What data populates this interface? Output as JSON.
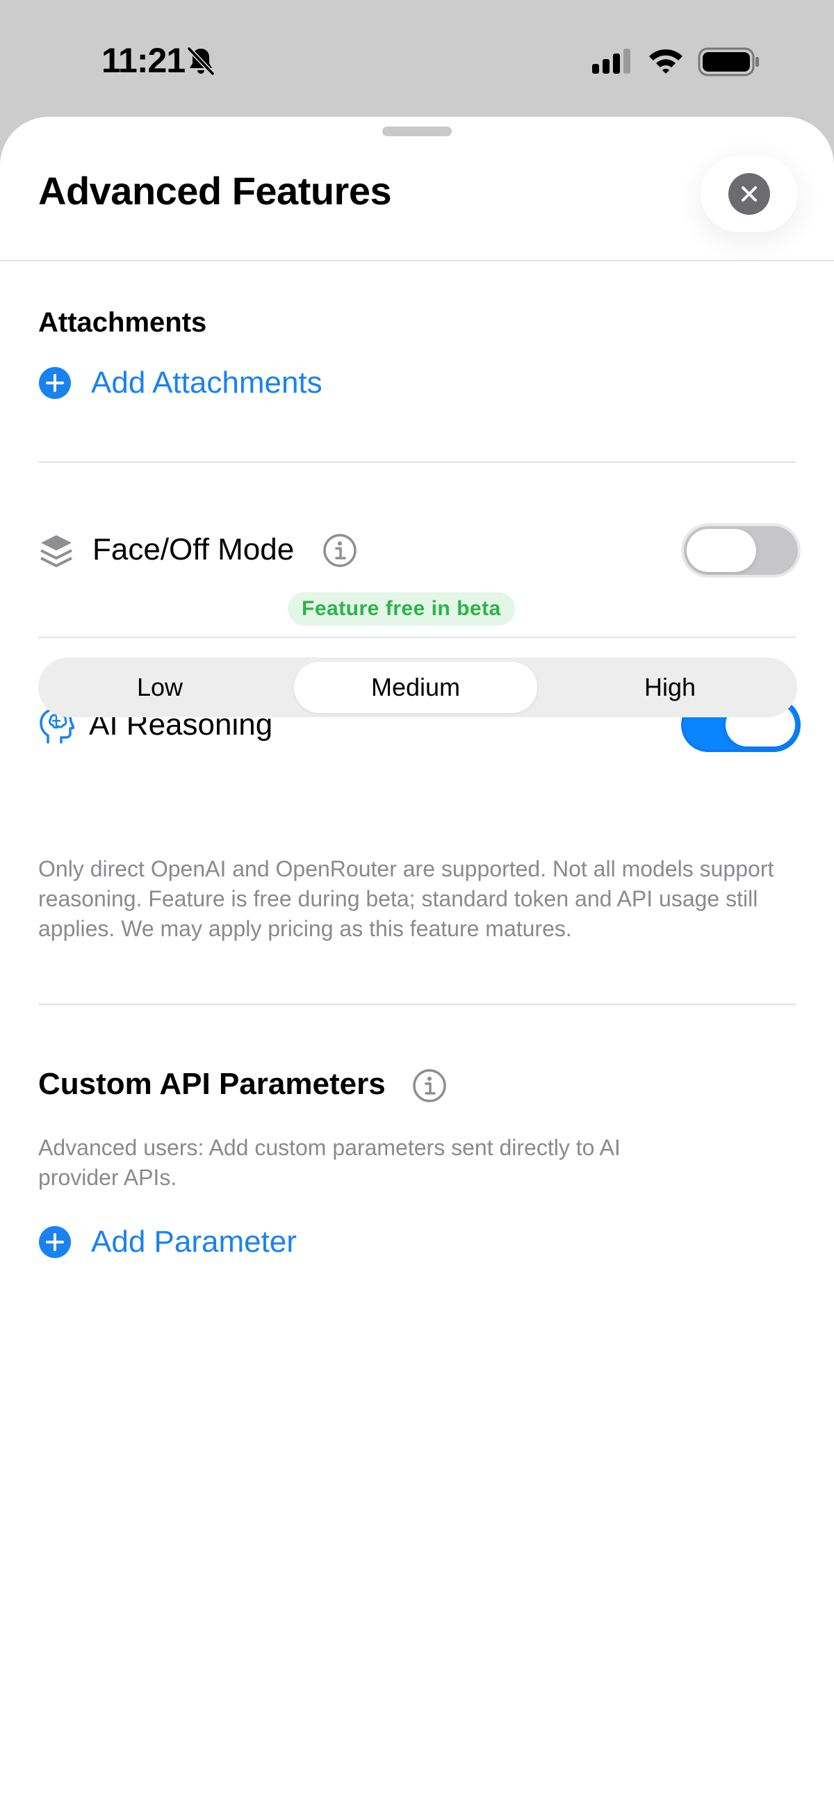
{
  "status_bar": {
    "time": "11:21",
    "icons": [
      "bell-slash-icon",
      "cellular-signal-icon",
      "wifi-icon",
      "battery-icon"
    ]
  },
  "sheet": {
    "title": "Advanced Features",
    "close_icon": "close-icon"
  },
  "attachments": {
    "label": "Attachments",
    "add_label": "Add Attachments",
    "icon": "plus-circle-icon"
  },
  "faceoff": {
    "label": "Face/Off Mode",
    "icon": "layers-icon",
    "info_icon": "info-icon",
    "enabled": false
  },
  "reasoning": {
    "label": "AI Reasoning",
    "icon": "brain-head-icon",
    "badge": "Feature free in beta",
    "enabled": true,
    "levels": [
      "Low",
      "Medium",
      "High"
    ],
    "selected_level": "Medium",
    "helper": "Only direct OpenAI and OpenRouter are supported. Not all models support reasoning. Feature is free during beta; standard token and API usage still applies. We may apply pricing as this feature matures."
  },
  "custom_params": {
    "label": "Custom API Parameters",
    "info_icon": "info-icon",
    "helper": "Advanced users: Add custom parameters sent directly to AI provider APIs.",
    "add_label": "Add Parameter",
    "icon": "plus-circle-icon"
  },
  "colors": {
    "accent": "#1a82f0",
    "toggle_on": "#0a84ff",
    "badge_text": "#2db34a",
    "badge_bg": "#e3f6e7",
    "secondary_text": "#8a8a8e"
  }
}
